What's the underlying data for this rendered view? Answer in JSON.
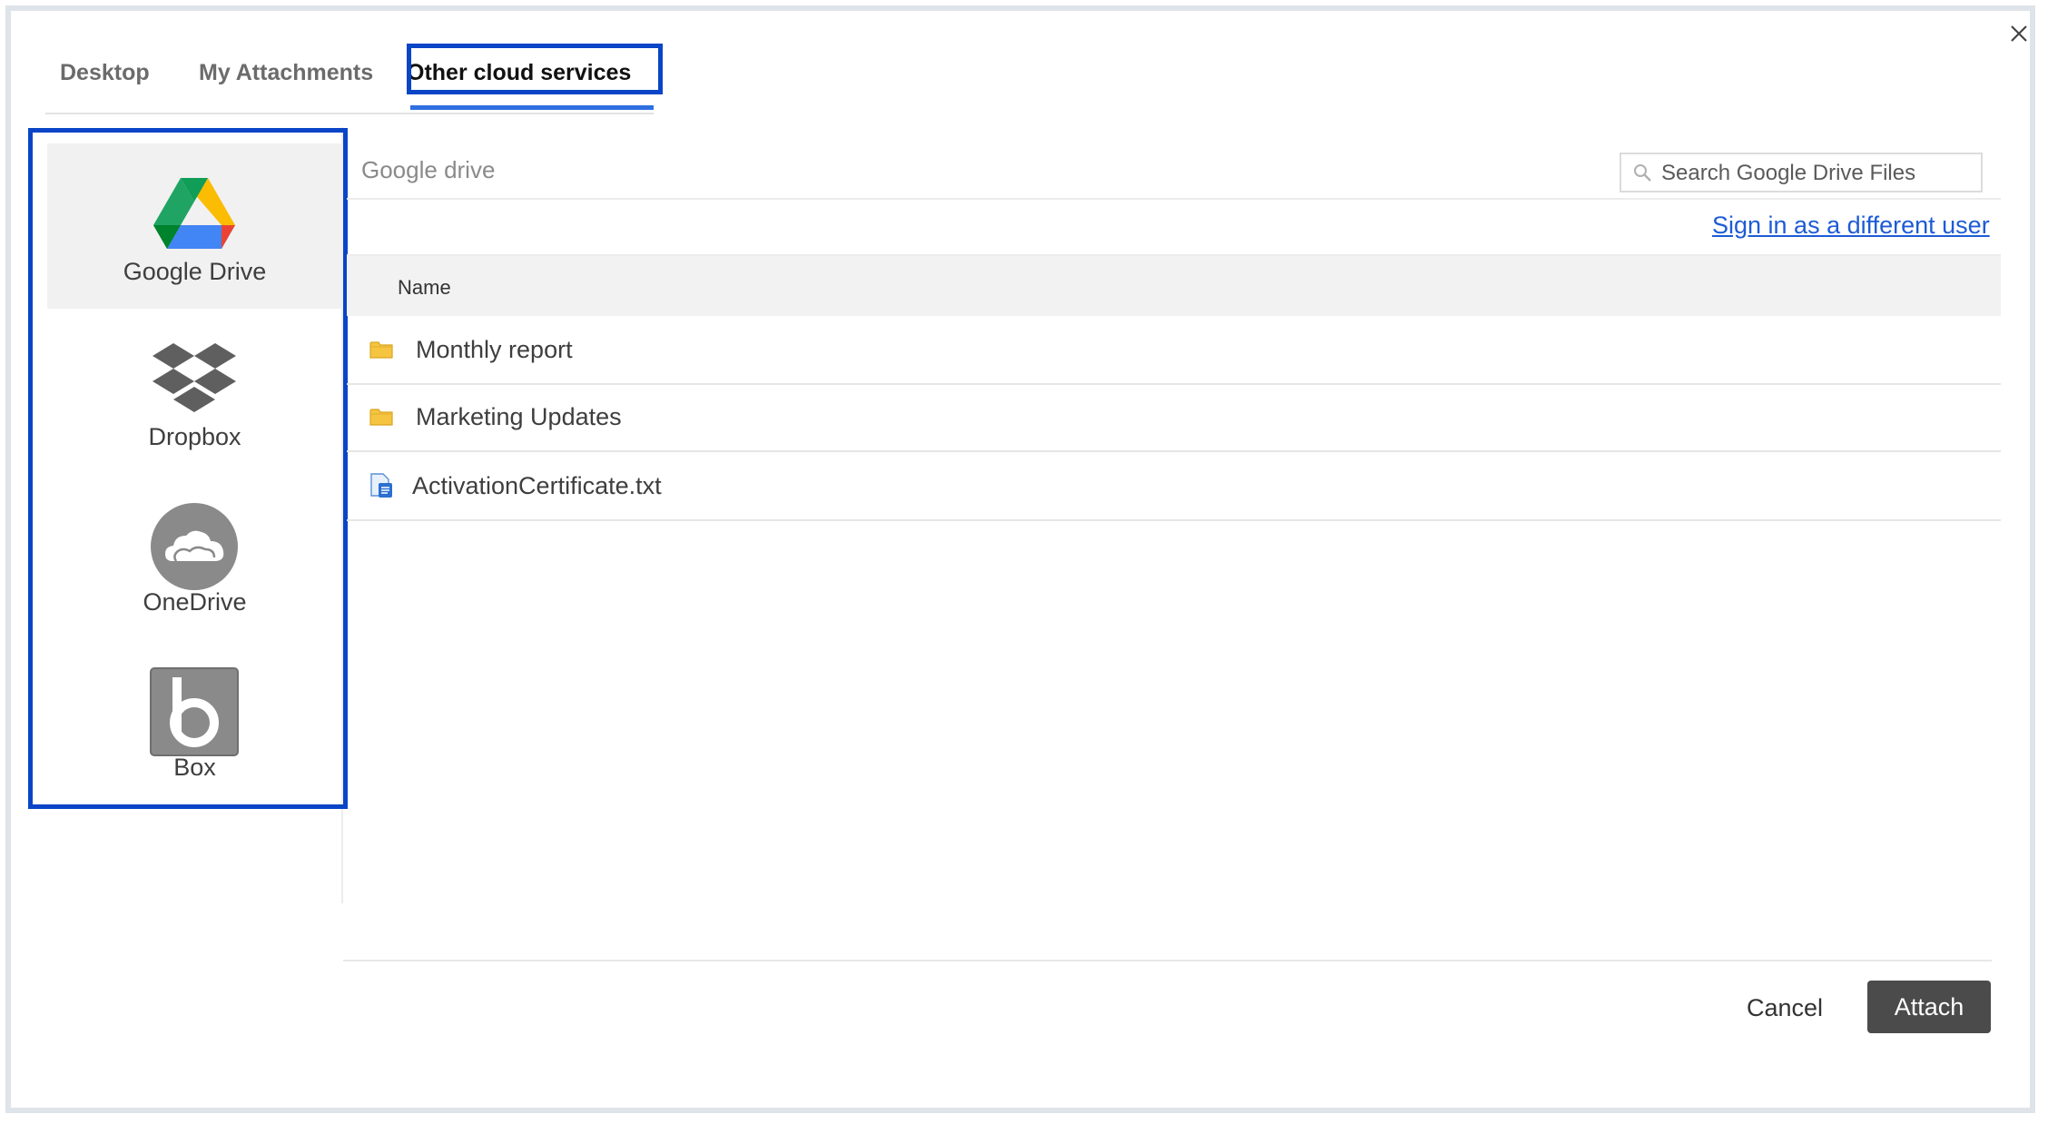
{
  "dialog": {
    "close_icon": "close-icon"
  },
  "tabs": [
    {
      "label": "Desktop",
      "active": false
    },
    {
      "label": "My Attachments",
      "active": false
    },
    {
      "label": "Other cloud services",
      "active": true
    }
  ],
  "providers": [
    {
      "label": "Google Drive",
      "icon": "google-drive-icon",
      "active": true
    },
    {
      "label": "Dropbox",
      "icon": "dropbox-icon",
      "active": false
    },
    {
      "label": "OneDrive",
      "icon": "onedrive-icon",
      "active": false
    },
    {
      "label": "Box",
      "icon": "box-icon",
      "active": false
    }
  ],
  "main": {
    "breadcrumb": "Google drive",
    "search_placeholder": "Search Google Drive Files",
    "signin_link": "Sign in as a different user",
    "column_name": "Name",
    "files": [
      {
        "name": "Monthly report",
        "type": "folder",
        "icon": "folder-icon"
      },
      {
        "name": "Marketing Updates",
        "type": "folder",
        "icon": "folder-icon"
      },
      {
        "name": "ActivationCertificate.txt",
        "type": "file",
        "icon": "text-file-icon"
      }
    ]
  },
  "footer": {
    "cancel_label": "Cancel",
    "attach_label": "Attach"
  },
  "colors": {
    "highlight_border": "#0a44c7",
    "tab_underline": "#2f6fe0",
    "link": "#1d5bd6",
    "attach_button": "#4b4b4b"
  }
}
